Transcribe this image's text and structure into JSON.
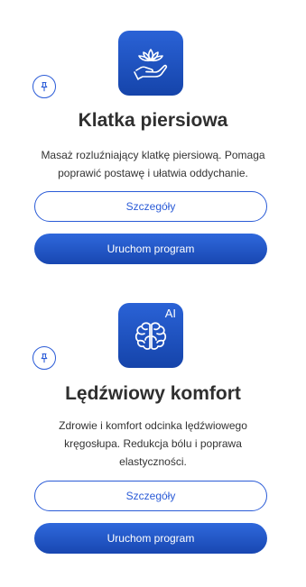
{
  "programs": [
    {
      "icon": "lotus-hand-icon",
      "badge": "",
      "title": "Klatka piersiowa",
      "description": "Masaż rozluźniający klatkę piersiową. Pomaga poprawić postawę i ułatwia oddychanie.",
      "details_label": "Szczegóły",
      "start_label": "Uruchom program"
    },
    {
      "icon": "brain-icon",
      "badge": "AI",
      "title": "Lędźwiowy komfort",
      "description": "Zdrowie i komfort odcinka lędźwiowego kręgosłupa. Redukcja bólu i poprawa elastyczności.",
      "details_label": "Szczegóły",
      "start_label": "Uruchom program"
    }
  ],
  "colors": {
    "accent": "#2a5bd7",
    "title": "#2f2f2f",
    "text": "#333333"
  }
}
